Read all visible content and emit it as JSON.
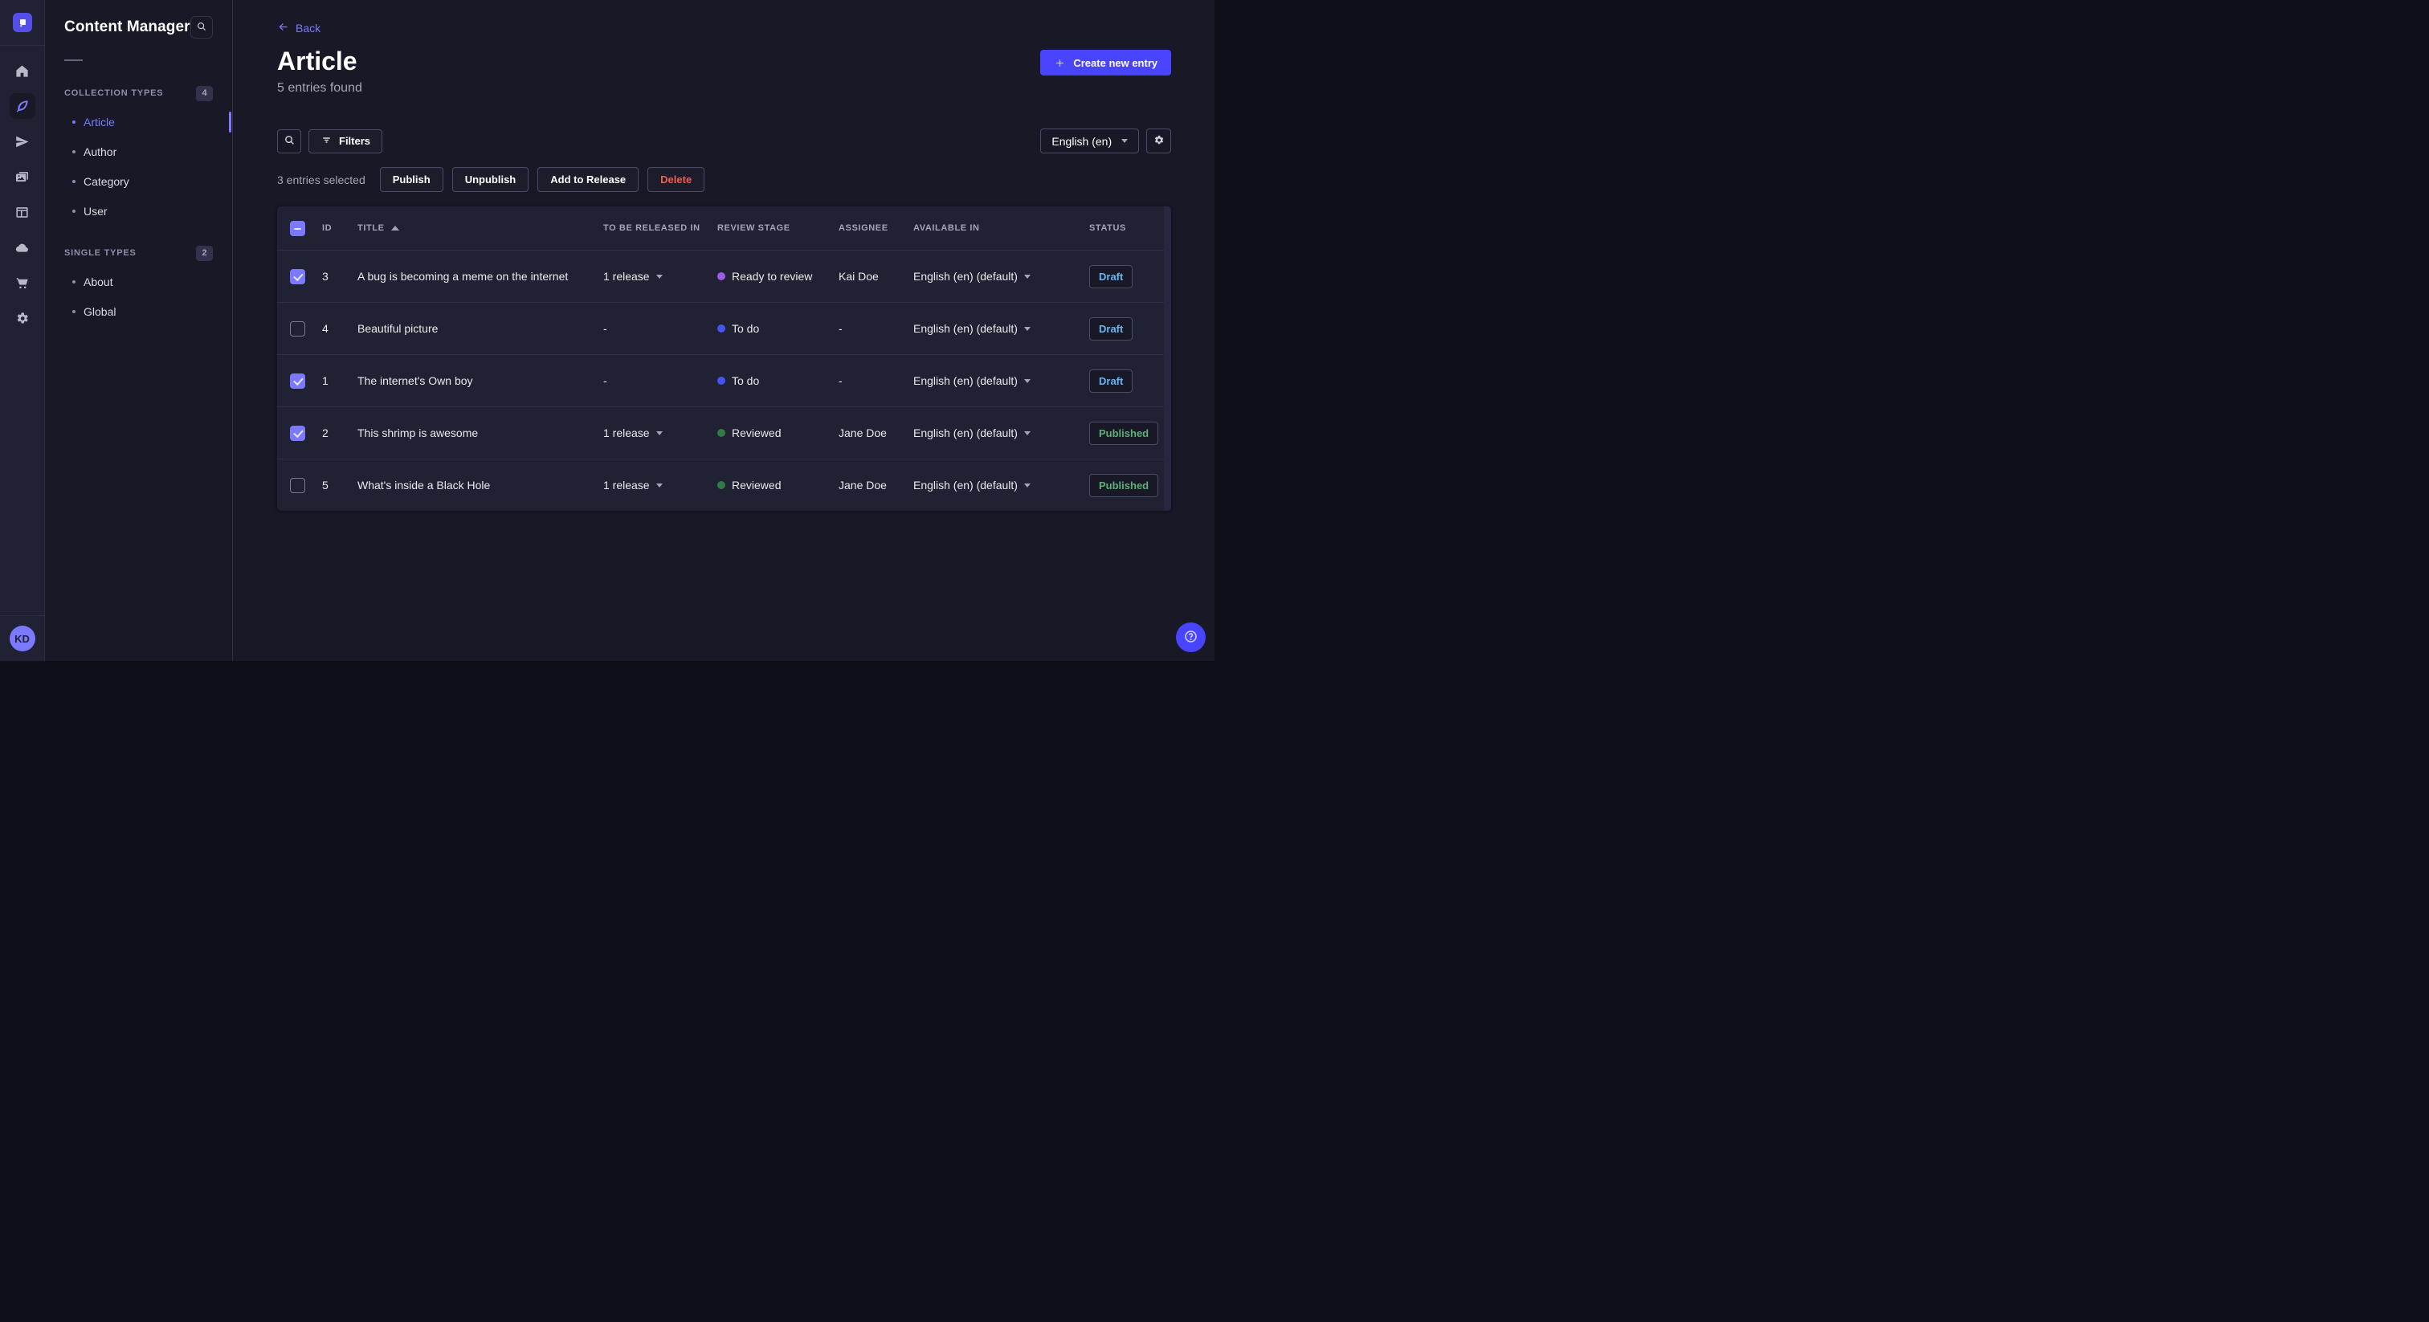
{
  "nav_rail": {
    "logo_icon": "strapi-logo-icon",
    "icons": [
      {
        "name": "home-icon",
        "active": false
      },
      {
        "name": "content-manager-feather-icon",
        "active": true
      },
      {
        "name": "releases-paper-plane-icon",
        "active": false
      },
      {
        "name": "media-library-icon",
        "active": false
      },
      {
        "name": "content-type-builder-icon",
        "active": false
      },
      {
        "name": "deploy-cloud-icon",
        "active": false
      },
      {
        "name": "marketplace-cart-icon",
        "active": false
      },
      {
        "name": "settings-gear-icon",
        "active": false
      }
    ],
    "avatar_initials": "KD"
  },
  "sidebar": {
    "title": "Content Manager",
    "search_icon": "search-icon",
    "sections": [
      {
        "label": "COLLECTION TYPES",
        "count": "4",
        "items": [
          {
            "label": "Article",
            "active": true
          },
          {
            "label": "Author",
            "active": false
          },
          {
            "label": "Category",
            "active": false
          },
          {
            "label": "User",
            "active": false
          }
        ]
      },
      {
        "label": "SINGLE TYPES",
        "count": "2",
        "items": [
          {
            "label": "About",
            "active": false
          },
          {
            "label": "Global",
            "active": false
          }
        ]
      }
    ]
  },
  "header": {
    "back_label": "Back",
    "back_icon": "arrow-left-icon",
    "title": "Article",
    "subtitle": "5 entries found",
    "create_button_label": "Create new entry",
    "create_button_icon": "plus-icon"
  },
  "toolbar": {
    "search_icon": "search-icon",
    "filters_icon": "filter-lines-icon",
    "filters_label": "Filters",
    "locale_value": "English (en)",
    "locale_caret_icon": "chevron-down-icon",
    "settings_icon": "gear-icon"
  },
  "selection": {
    "summary": "3 entries selected",
    "publish_label": "Publish",
    "unpublish_label": "Unpublish",
    "add_to_release_label": "Add to Release",
    "delete_label": "Delete"
  },
  "table": {
    "header_checkbox_state": "indeterminate",
    "sorted_column": "TITLE",
    "sort_direction": "ascending",
    "columns": [
      "ID",
      "TITLE",
      "TO BE RELEASED IN",
      "REVIEW STAGE",
      "ASSIGNEE",
      "AVAILABLE IN",
      "STATUS"
    ],
    "rows": [
      {
        "checked": true,
        "id": "3",
        "title": "A bug is becoming a meme on the internet",
        "release": "1 release",
        "has_release": true,
        "stage": {
          "label": "Ready to review",
          "color": "#9d5be8"
        },
        "assignee": "Kai Doe",
        "available": "English (en) (default)",
        "status": {
          "label": "Draft",
          "variant": "draft"
        }
      },
      {
        "checked": false,
        "id": "4",
        "title": "Beautiful picture",
        "release": "-",
        "has_release": false,
        "stage": {
          "label": "To do",
          "color": "#4356f4"
        },
        "assignee": "-",
        "available": "English (en) (default)",
        "status": {
          "label": "Draft",
          "variant": "draft"
        }
      },
      {
        "checked": true,
        "id": "1",
        "title": "The internet's Own boy",
        "release": "-",
        "has_release": false,
        "stage": {
          "label": "To do",
          "color": "#4356f4"
        },
        "assignee": "-",
        "available": "English (en) (default)",
        "status": {
          "label": "Draft",
          "variant": "draft"
        }
      },
      {
        "checked": true,
        "id": "2",
        "title": "This shrimp is awesome",
        "release": "1 release",
        "has_release": true,
        "stage": {
          "label": "Reviewed",
          "color": "#2f7d46"
        },
        "assignee": "Jane Doe",
        "available": "English (en) (default)",
        "status": {
          "label": "Published",
          "variant": "published"
        }
      },
      {
        "checked": false,
        "id": "5",
        "title": "What's inside a Black Hole",
        "release": "1 release",
        "has_release": true,
        "stage": {
          "label": "Reviewed",
          "color": "#2f7d46"
        },
        "assignee": "Jane Doe",
        "available": "English (en) (default)",
        "status": {
          "label": "Published",
          "variant": "published"
        }
      }
    ]
  },
  "help_button": {
    "icon": "question-mark-circle-icon"
  },
  "colors": {
    "primary": "#4945ff",
    "link": "#7b79ff",
    "draft_text": "#66b7f1",
    "published_text": "#5cb176",
    "danger_text": "#ee5e52",
    "panel_bg": "#212134",
    "page_bg": "#181826"
  }
}
